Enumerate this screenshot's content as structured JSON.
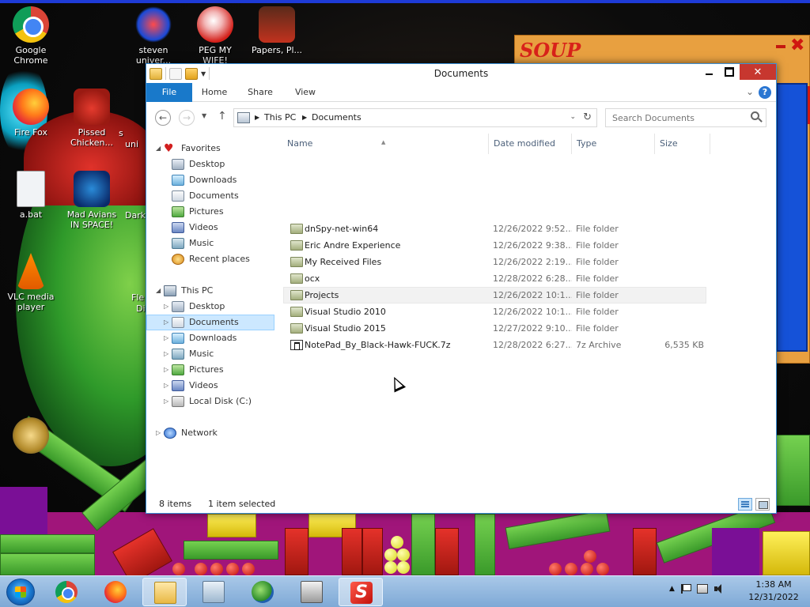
{
  "desktop": {
    "icons": [
      {
        "label": "Google Chrome"
      },
      {
        "label": "Fire Fox"
      },
      {
        "label": "a.bat"
      },
      {
        "label": "VLC media player"
      },
      {
        "label": "Pissed Chicken..."
      },
      {
        "label": "Mad Avians IN SPACE!"
      },
      {
        "label": "steven univer..."
      },
      {
        "label": "PEG MY WIFE!"
      },
      {
        "label": "Papers, Pl..."
      }
    ],
    "partial_labels": {
      "su": "s",
      "uni": "uni",
      "dark": "Dark",
      "fle": "Fle",
      "di": "Di"
    }
  },
  "background_window": {
    "title": "SOUP"
  },
  "explorer": {
    "title": "Documents",
    "ribbon": {
      "tabs": [
        "File",
        "Home",
        "Share",
        "View"
      ]
    },
    "address": {
      "crumbs": [
        "This PC",
        "Documents"
      ]
    },
    "search": {
      "placeholder": "Search Documents"
    },
    "nav": {
      "favorites_label": "Favorites",
      "favorites": [
        "Desktop",
        "Downloads",
        "Documents",
        "Pictures",
        "Videos",
        "Music",
        "Recent places"
      ],
      "thispc_label": "This PC",
      "thispc": [
        "Desktop",
        "Documents",
        "Downloads",
        "Music",
        "Pictures",
        "Videos",
        "Local Disk (C:)"
      ],
      "network_label": "Network"
    },
    "columns": {
      "name": "Name",
      "date": "Date modified",
      "type": "Type",
      "size": "Size"
    },
    "files": [
      {
        "name": "dnSpy-net-win64",
        "date": "12/26/2022 9:52...",
        "type": "File folder",
        "size": "",
        "icon": "folder-icon"
      },
      {
        "name": "Eric Andre Experience",
        "date": "12/26/2022 9:38...",
        "type": "File folder",
        "size": "",
        "icon": "folder-icon"
      },
      {
        "name": "My Received Files",
        "date": "12/26/2022 2:19...",
        "type": "File folder",
        "size": "",
        "icon": "folder-icon"
      },
      {
        "name": "ocx",
        "date": "12/28/2022 6:28...",
        "type": "File folder",
        "size": "",
        "icon": "folder-icon"
      },
      {
        "name": "Projects",
        "date": "12/26/2022 10:1...",
        "type": "File folder",
        "size": "",
        "icon": "folder-icon"
      },
      {
        "name": "Visual Studio 2010",
        "date": "12/26/2022 10:1...",
        "type": "File folder",
        "size": "",
        "icon": "folder-icon"
      },
      {
        "name": "Visual Studio 2015",
        "date": "12/27/2022 9:10...",
        "type": "File folder",
        "size": "",
        "icon": "folder-icon"
      },
      {
        "name": "NotePad_By_Black-Hawk-FUCK.7z",
        "date": "12/28/2022 6:27...",
        "type": "7z Archive",
        "size": "6,535 KB",
        "icon": "archive-icon"
      }
    ],
    "status": {
      "items": "8 items",
      "selected": "1 item selected"
    }
  },
  "taskbar": {
    "clock_time": "1:38 AM",
    "clock_date": "12/31/2022"
  }
}
